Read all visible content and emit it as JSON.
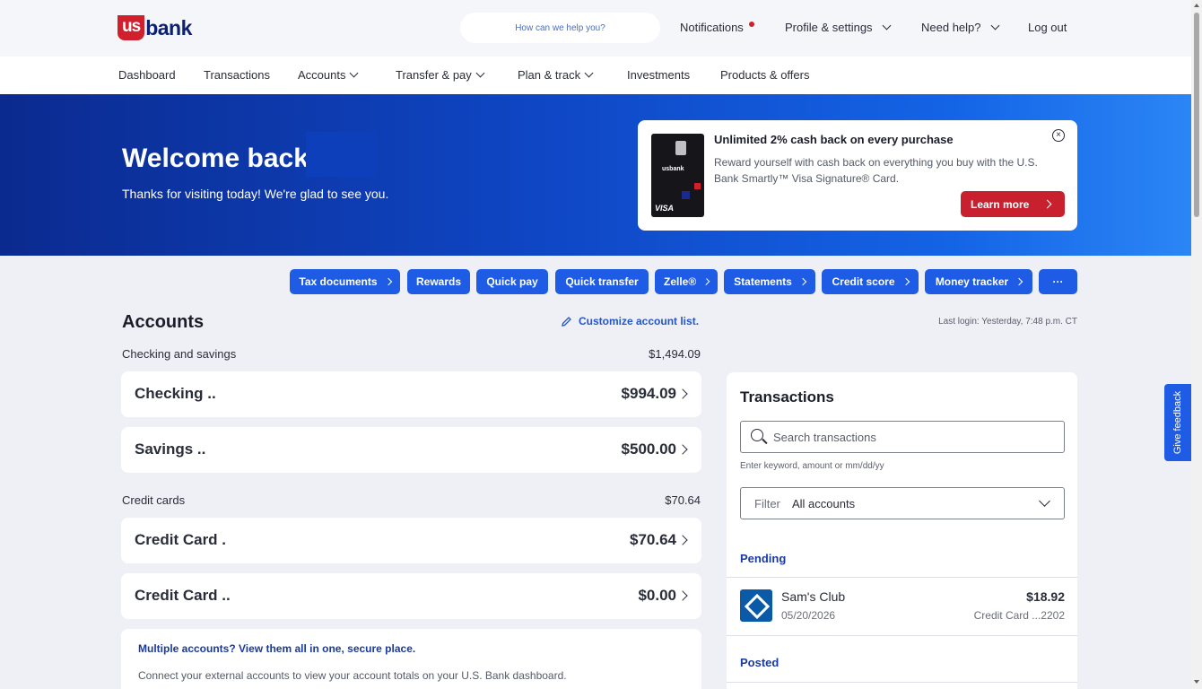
{
  "header": {
    "logo_us": "us",
    "logo_bank": "bank",
    "search_placeholder": "How can we help you?",
    "notifications": "Notifications",
    "profile": "Profile & settings",
    "help": "Need help?",
    "logout": "Log out"
  },
  "nav": {
    "items": [
      "Dashboard",
      "Transactions",
      "Accounts",
      "Transfer & pay",
      "Plan & track",
      "Investments",
      "Products & offers"
    ]
  },
  "hero": {
    "welcome": "Welcome back,",
    "subtitle": "Thanks for visiting today! We're glad to see you."
  },
  "promo": {
    "title": "Unlimited 2% cash back on every purchase",
    "text": "Reward yourself with cash back on everything you buy with the U.S. Bank Smartly™ Visa Signature® Card.",
    "cta": "Learn more",
    "card_brand": "VISA",
    "card_logo": "usbank"
  },
  "quick_actions": [
    "Tax documents",
    "Rewards",
    "Quick pay",
    "Quick transfer",
    "Zelle®",
    "Statements",
    "Credit score",
    "Money tracker",
    "···"
  ],
  "accounts": {
    "title": "Accounts",
    "customize": "Customize account list.",
    "last_login": "Last login: Yesterday, 7:48 p.m. CT",
    "checking_savings": {
      "label": "Checking and savings",
      "total": "$1,494.09",
      "items": [
        {
          "name": "Checking ..",
          "balance": "$994.09"
        },
        {
          "name": "Savings ..",
          "balance": "$500.00"
        }
      ]
    },
    "credit_cards": {
      "label": "Credit cards",
      "total": "$70.64",
      "items": [
        {
          "name": "Credit Card .",
          "balance": "$70.64"
        },
        {
          "name": "Credit Card ..",
          "balance": "$0.00"
        }
      ]
    },
    "external": {
      "title": "Multiple accounts? View them all in one, secure place.",
      "text": "Connect your external accounts to view your account totals on your U.S. Bank dashboard."
    }
  },
  "transactions": {
    "title": "Transactions",
    "search_placeholder": "Search transactions",
    "search_hint": "Enter keyword, amount or mm/dd/yy",
    "filter_label": "Filter",
    "filter_value": "All accounts",
    "pending_label": "Pending",
    "pending": [
      {
        "merchant": "Sam's Club",
        "date": "05/20/2026",
        "amount": "$18.92",
        "account": "Credit Card ...2202"
      }
    ],
    "posted_label": "Posted"
  },
  "feedback": "Give feedback",
  "colors": {
    "brand_blue": "#1f5ce6",
    "brand_red": "#c8202f",
    "navy": "#0c2074"
  }
}
